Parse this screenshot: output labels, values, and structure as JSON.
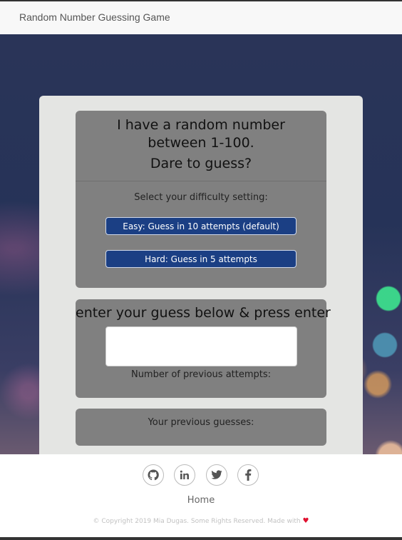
{
  "navbar": {
    "brand": "Random Number Guessing Game"
  },
  "intro": {
    "line1": "I have a random number",
    "line2": "between 1-100.",
    "line3": "Dare to guess?"
  },
  "difficulty": {
    "label": "Select your difficulty setting:",
    "easy_label": "Easy: Guess in 10 attempts (default)",
    "hard_label": "Hard: Guess in 5 attempts"
  },
  "guess": {
    "prompt": "enter your guess below & press enter",
    "input_value": "",
    "attempts_label": "Number of previous attempts:"
  },
  "previous": {
    "label": "Your previous guesses:"
  },
  "footer": {
    "social_icons": [
      "github-icon",
      "linkedin-icon",
      "twitter-icon",
      "facebook-icon"
    ],
    "home_link": "Home",
    "copyright": "© Copyright 2019 Mia Dugas. Some Rights Reserved. Made with",
    "heart": "♥"
  },
  "colors": {
    "button_blue": "#1b3f84",
    "panel_gray": "#808080",
    "card_bg": "#e4e5e3",
    "heart_red": "#e0102f"
  }
}
